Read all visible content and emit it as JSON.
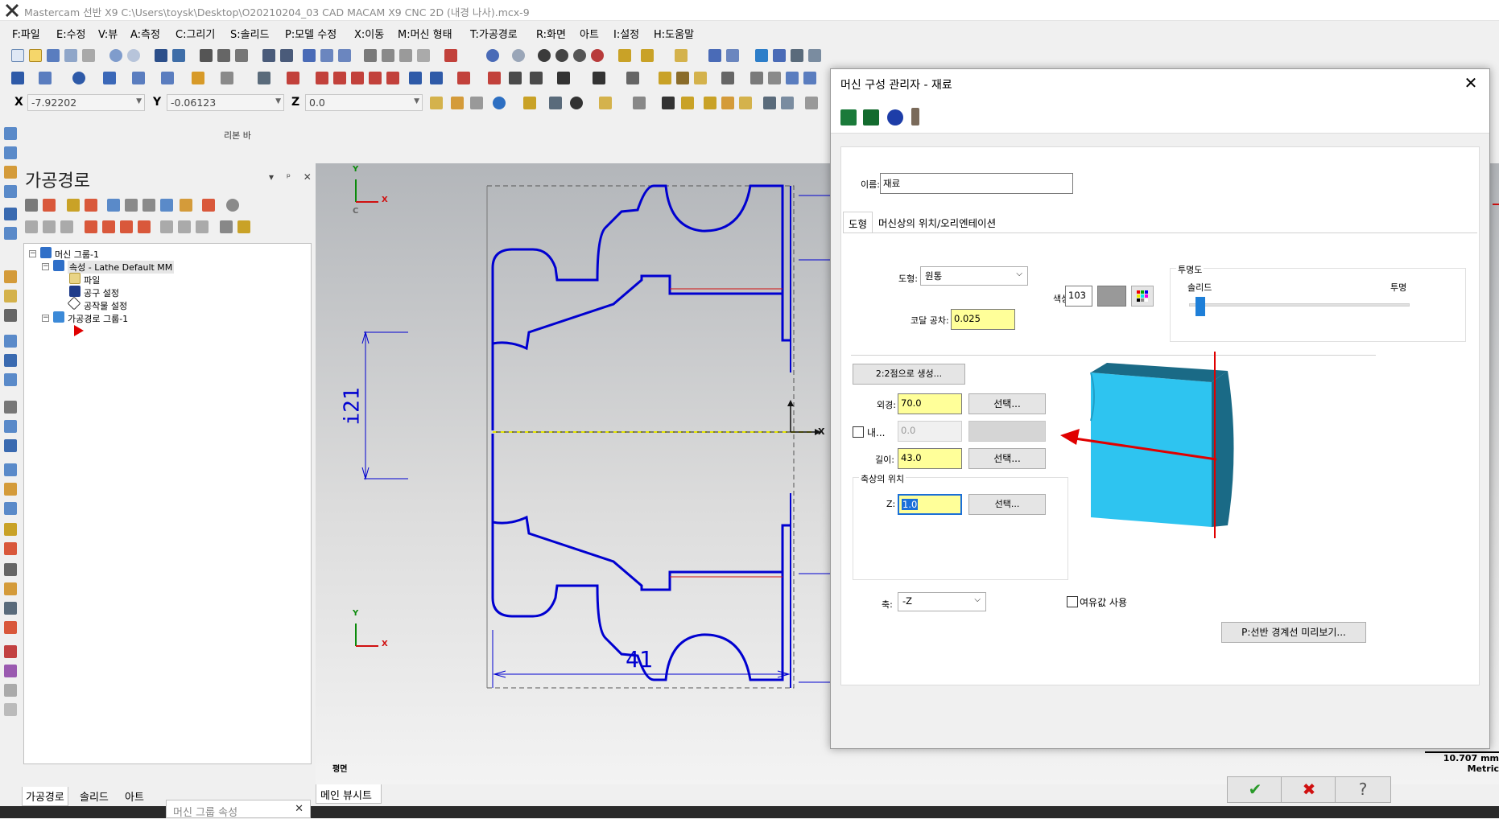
{
  "app": {
    "title": "Mastercam 선반 X9  C:\\Users\\toysk\\Desktop\\O20210204_03 CAD MACAM X9 CNC 2D (내경 나사).mcx-9"
  },
  "menu": [
    "F:파일",
    "E:수정",
    "V:뷰",
    "A:측정",
    "C:그리기",
    "S:솔리드",
    "P:모델 수정",
    "X:이동",
    "M:머신 형태",
    "T:가공경로",
    "R:화면",
    "아트",
    "I:설정",
    "H:도움말"
  ],
  "coords": {
    "x_label": "X",
    "x_value": "-7.92202",
    "y_label": "Y",
    "y_value": "-0.06123",
    "z_label": "Z",
    "z_value": "0.0"
  },
  "ribbon_bar_label": "리본 바",
  "toolpath_panel": {
    "title": "가공경로",
    "controls": "▾ ᵖ ✕",
    "tree": {
      "machine_group": "머신 그룹-1",
      "properties": "속성 - Lathe Default MM",
      "files": "파일",
      "tool_settings": "공구 설정",
      "stock_setup": "공작물 설정",
      "toolpath_group": "가공경로 그룹-1"
    },
    "bottom_tabs": [
      "가공경로",
      "솔리드",
      "아트"
    ]
  },
  "viewport": {
    "view_label": "평면",
    "sheet_tab": "메인 뷰시트",
    "scale": "10.707 mm",
    "units": "Metric",
    "dimension_horizontal": "41",
    "dimension_vertical": "i21",
    "axis_x": "X",
    "axis_y": "Y",
    "axis_c": "C"
  },
  "popup_tab": {
    "label": "머신 그룹 속성",
    "close": "✕"
  },
  "dialog": {
    "title": "머신 구성 관리자 - 재료",
    "close": "✕",
    "name_label": "이름:",
    "name_value": "재료",
    "tabs": [
      "도형",
      "머신상의 위치/오리엔테이션"
    ],
    "shape_label": "도형:",
    "shape_value": "원통",
    "color_label": "색상:",
    "color_value": "103",
    "chord_tol_label": "코달 공차:",
    "chord_tol_value": "0.025",
    "transparency_group_label": "투명도",
    "transparency_solid": "솔리드",
    "transparency_transparent": "투명",
    "create_from_2pts": "2:2점으로 생성...",
    "outer_dia_label": "외경:",
    "outer_dia_value": "70.0",
    "select_label": "선택...",
    "inner_dia_label": "내...",
    "inner_dia_value": "0.0",
    "length_label": "길이:",
    "length_value": "43.0",
    "axis_pos_group": "축상의 위치",
    "z_label": "Z:",
    "z_value": "1.0",
    "axis_label": "축:",
    "axis_value": "-Z",
    "use_margin": "여유값 사용",
    "preview_boundary": "P:선반 경계선 미리보기...",
    "ok_icon": "✔",
    "cancel_icon": "✖",
    "help_icon": "?"
  },
  "colors": {
    "drawing_blue": "#0000d0",
    "stock_cyan": "#2ec4f0",
    "stock_dark": "#1a6a86",
    "arrow_red": "#e00000",
    "field_yellow": "#ffff99",
    "color_swatch": "#999999",
    "slider_blue": "#1e7fd8"
  }
}
